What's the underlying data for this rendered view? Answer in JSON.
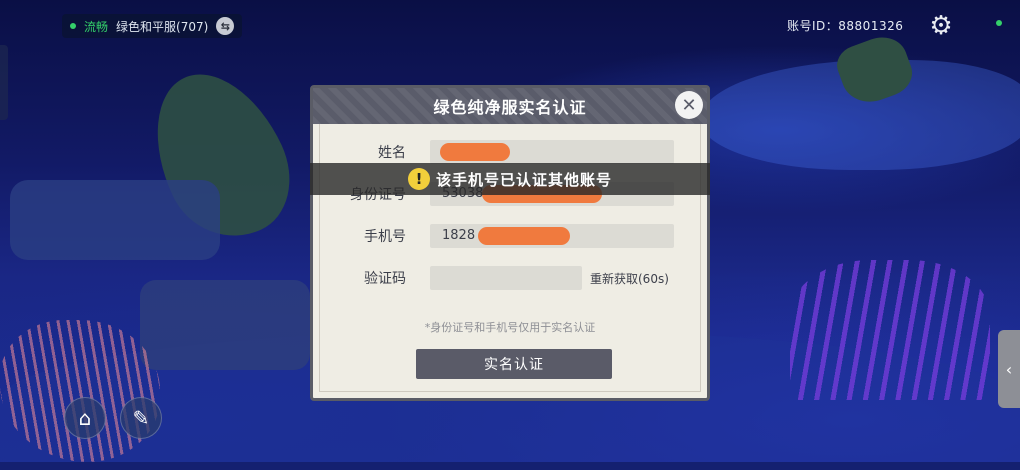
{
  "hud": {
    "status": "流畅",
    "server": "绿色和平服(707)",
    "account_label": "账号ID：88801326",
    "status_color": "#34d06a"
  },
  "dialog": {
    "title": "绿色纯净服实名认证",
    "fields": {
      "name_label": "姓名",
      "id_label": "身份证号",
      "id_value": "53038",
      "phone_label": "手机号",
      "phone_value": "1828",
      "code_label": "验证码",
      "code_value": ""
    },
    "resend_label": "重新获取(60s)",
    "hint": "*身份证号和手机号仅用于实名认证",
    "submit_label": "实名认证"
  },
  "toast": {
    "message": "该手机号已认证其他账号"
  },
  "icons": {
    "switch": "swap-icon",
    "settings": "gear-icon",
    "close": "close-icon",
    "home": "home-icon",
    "craft": "craft-icon",
    "expand": "chevron-left-icon",
    "warning": "warning-icon"
  },
  "colors": {
    "accent": "#f2cf3b",
    "dialog_header": "#5a5c6a",
    "redaction": "#f07a3e"
  }
}
